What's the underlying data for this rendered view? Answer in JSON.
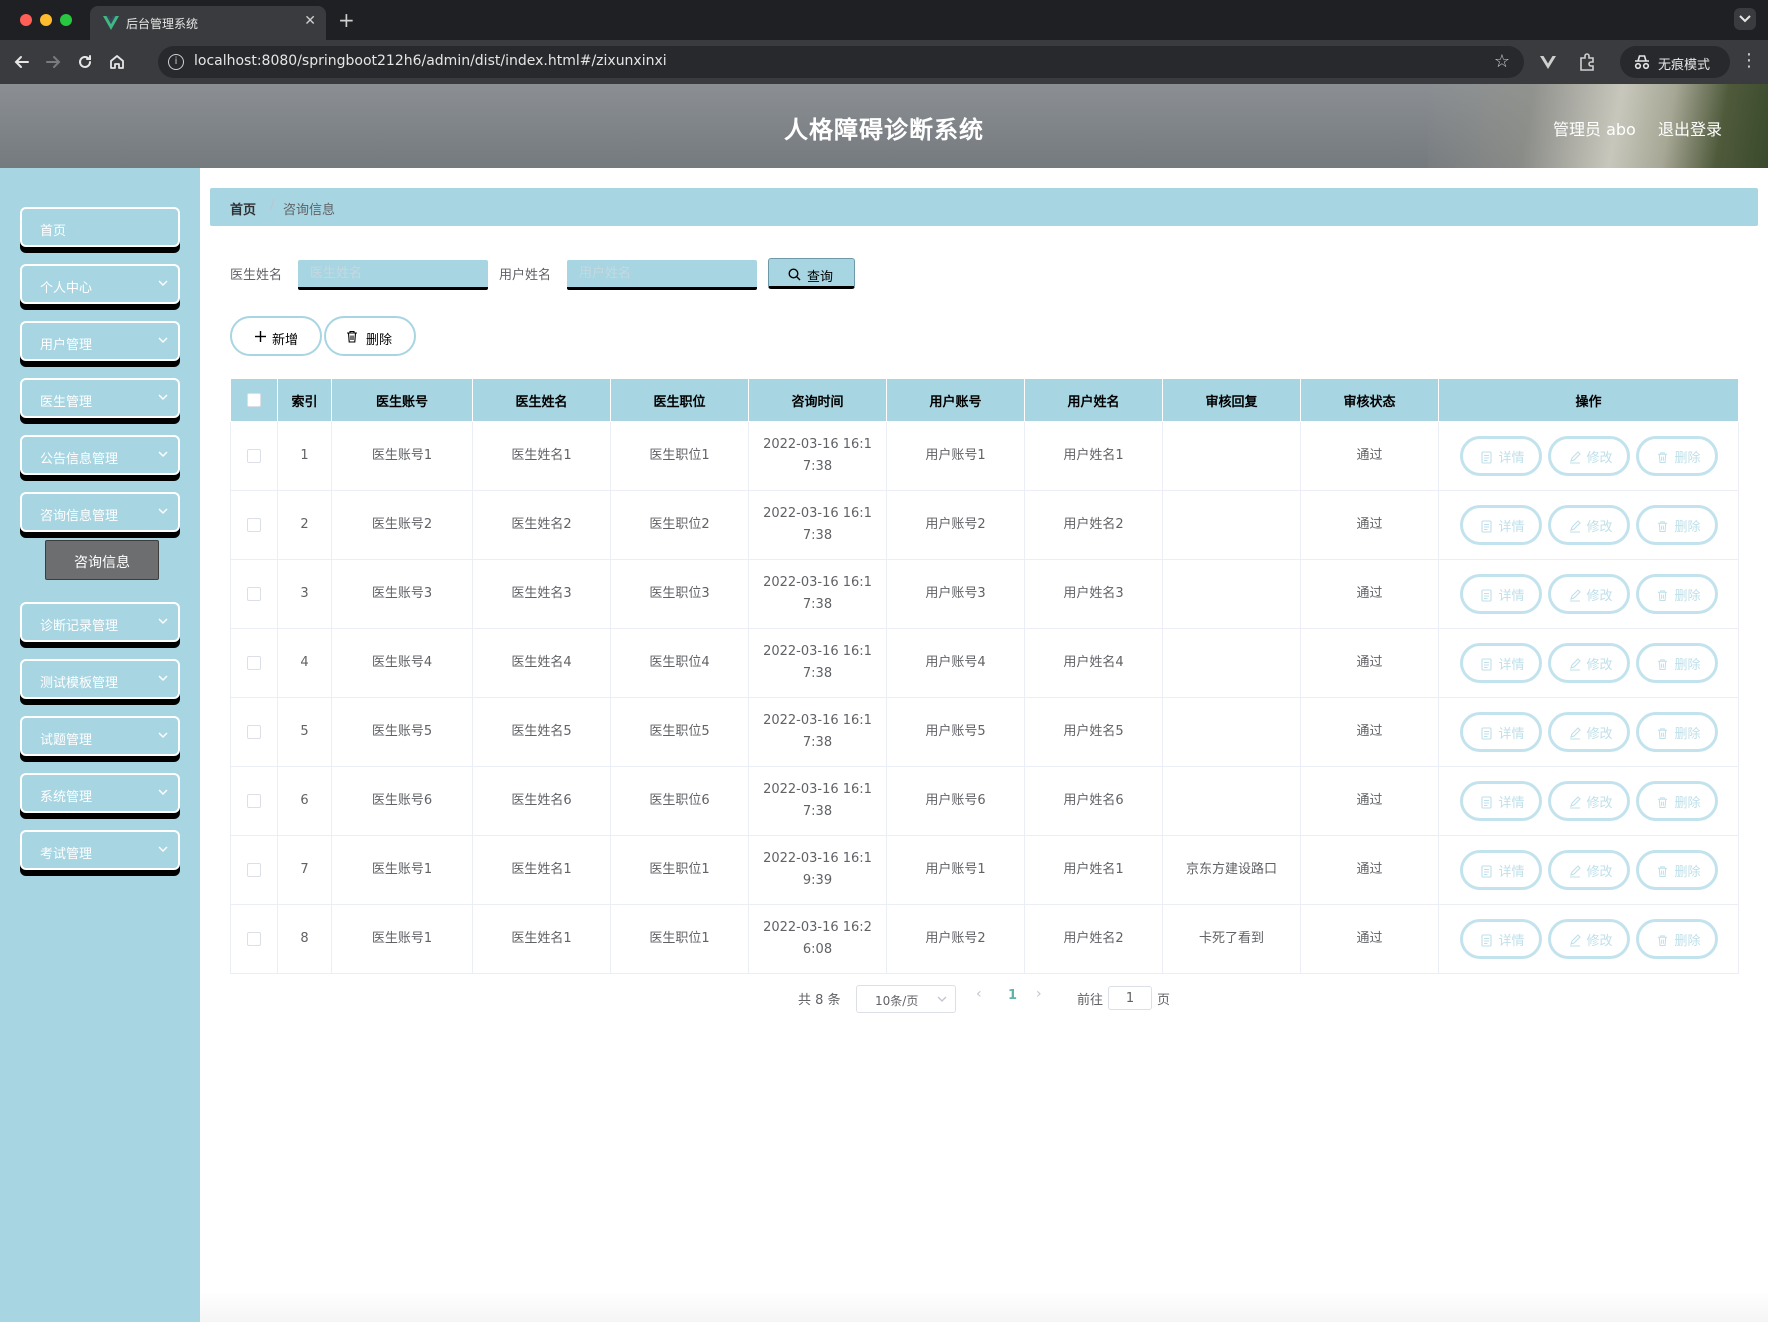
{
  "browser": {
    "tab_title": "后台管理系统",
    "url": "localhost:8080/springboot212h6/admin/dist/index.html#/zixunxinxi",
    "incognito_label": "无痕模式"
  },
  "header": {
    "title": "人格障碍诊断系统",
    "user_label": "管理员 abo",
    "logout_label": "退出登录"
  },
  "sidebar": {
    "items": [
      {
        "label": "首页",
        "has_chevron": false
      },
      {
        "label": "个人中心",
        "has_chevron": true
      },
      {
        "label": "用户管理",
        "has_chevron": true
      },
      {
        "label": "医生管理",
        "has_chevron": true
      },
      {
        "label": "公告信息管理",
        "has_chevron": true
      },
      {
        "label": "咨询信息管理",
        "has_chevron": true
      },
      {
        "label": "诊断记录管理",
        "has_chevron": true
      },
      {
        "label": "测试模板管理",
        "has_chevron": true
      },
      {
        "label": "试题管理",
        "has_chevron": true
      },
      {
        "label": "系统管理",
        "has_chevron": true
      },
      {
        "label": "考试管理",
        "has_chevron": true
      }
    ],
    "active_submenu": "咨询信息"
  },
  "breadcrumb": {
    "home": "首页",
    "separator": "/",
    "current": "咨询信息"
  },
  "search": {
    "doctor_label": "医生姓名",
    "doctor_placeholder": "医生姓名",
    "user_label": "用户姓名",
    "user_placeholder": "用户姓名",
    "query_label": "查询"
  },
  "actions": {
    "add_label": "新增",
    "delete_label": "删除"
  },
  "table": {
    "columns": [
      "索引",
      "医生账号",
      "医生姓名",
      "医生职位",
      "咨询时间",
      "用户账号",
      "用户姓名",
      "审核回复",
      "审核状态",
      "操作"
    ],
    "rows": [
      {
        "index": "1",
        "doctor_account": "医生账号1",
        "doctor_name": "医生姓名1",
        "doctor_position": "医生职位1",
        "time": "2022-03-16 16:17:38",
        "user_account": "用户账号1",
        "user_name": "用户姓名1",
        "reply": "",
        "status": "通过"
      },
      {
        "index": "2",
        "doctor_account": "医生账号2",
        "doctor_name": "医生姓名2",
        "doctor_position": "医生职位2",
        "time": "2022-03-16 16:17:38",
        "user_account": "用户账号2",
        "user_name": "用户姓名2",
        "reply": "",
        "status": "通过"
      },
      {
        "index": "3",
        "doctor_account": "医生账号3",
        "doctor_name": "医生姓名3",
        "doctor_position": "医生职位3",
        "time": "2022-03-16 16:17:38",
        "user_account": "用户账号3",
        "user_name": "用户姓名3",
        "reply": "",
        "status": "通过"
      },
      {
        "index": "4",
        "doctor_account": "医生账号4",
        "doctor_name": "医生姓名4",
        "doctor_position": "医生职位4",
        "time": "2022-03-16 16:17:38",
        "user_account": "用户账号4",
        "user_name": "用户姓名4",
        "reply": "",
        "status": "通过"
      },
      {
        "index": "5",
        "doctor_account": "医生账号5",
        "doctor_name": "医生姓名5",
        "doctor_position": "医生职位5",
        "time": "2022-03-16 16:17:38",
        "user_account": "用户账号5",
        "user_name": "用户姓名5",
        "reply": "",
        "status": "通过"
      },
      {
        "index": "6",
        "doctor_account": "医生账号6",
        "doctor_name": "医生姓名6",
        "doctor_position": "医生职位6",
        "time": "2022-03-16 16:17:38",
        "user_account": "用户账号6",
        "user_name": "用户姓名6",
        "reply": "",
        "status": "通过"
      },
      {
        "index": "7",
        "doctor_account": "医生账号1",
        "doctor_name": "医生姓名1",
        "doctor_position": "医生职位1",
        "time": "2022-03-16 16:19:39",
        "user_account": "用户账号1",
        "user_name": "用户姓名1",
        "reply": "京东方建设路口",
        "status": "通过"
      },
      {
        "index": "8",
        "doctor_account": "医生账号1",
        "doctor_name": "医生姓名1",
        "doctor_position": "医生职位1",
        "time": "2022-03-16 16:26:08",
        "user_account": "用户账号2",
        "user_name": "用户姓名2",
        "reply": "卡死了看到",
        "status": "通过"
      }
    ],
    "row_actions": {
      "detail": "详情",
      "edit": "修改",
      "delete": "删除"
    }
  },
  "pagination": {
    "total_text": "共 8 条",
    "page_size": "10条/页",
    "current_page": "1",
    "goto_prefix": "前往",
    "goto_value": "1",
    "goto_suffix": "页"
  }
}
